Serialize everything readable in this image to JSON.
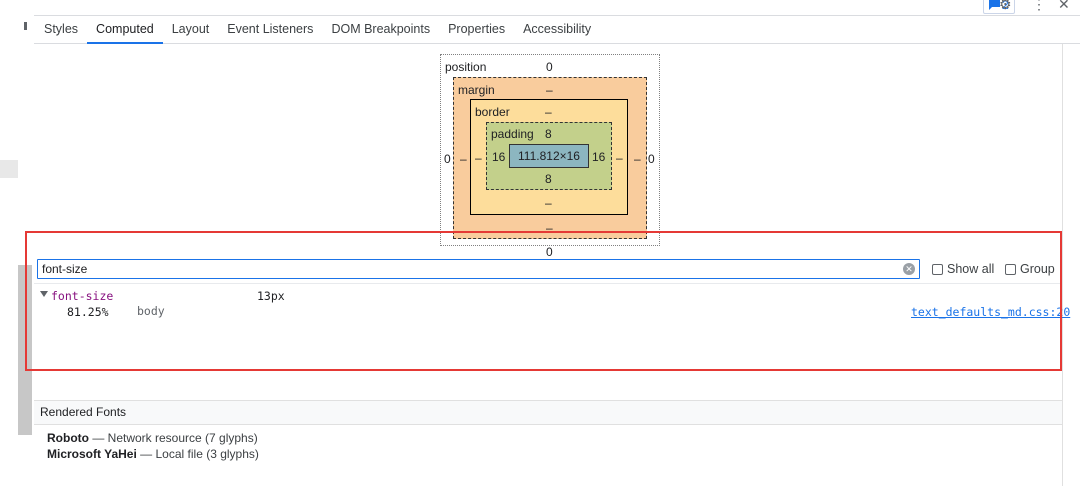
{
  "top_bar": {
    "issues_count": "2",
    "settings_icon": "gear-icon",
    "more_icon": "kebab-menu-icon",
    "close_icon": "close-icon"
  },
  "tabs": [
    {
      "label": "Styles",
      "active": false
    },
    {
      "label": "Computed",
      "active": true
    },
    {
      "label": "Layout",
      "active": false
    },
    {
      "label": "Event Listeners",
      "active": false
    },
    {
      "label": "DOM Breakpoints",
      "active": false
    },
    {
      "label": "Properties",
      "active": false
    },
    {
      "label": "Accessibility",
      "active": false
    }
  ],
  "box_model": {
    "position": {
      "label": "position",
      "top": "0",
      "right": "0",
      "bottom": "0",
      "left": "0"
    },
    "margin": {
      "label": "margin",
      "top": "–",
      "right": "–",
      "bottom": "–",
      "left": "–"
    },
    "border": {
      "label": "border",
      "top": "–",
      "right": "–",
      "bottom": "–",
      "left": "–"
    },
    "padding": {
      "label": "padding",
      "top": "8",
      "right": "16",
      "bottom": "8",
      "left": "16"
    },
    "content": "111.812×16",
    "colors": {
      "margin": "#f9cc9d",
      "border": "#fddd9b",
      "padding": "#c3d08b",
      "content": "#8cb6c0"
    }
  },
  "filter": {
    "value": "font-size",
    "show_all_label": "Show all",
    "group_label": "Group",
    "show_all_checked": false,
    "group_checked": false
  },
  "property": {
    "name": "font-size",
    "value": "13px",
    "trace": {
      "value": "81.25%",
      "selector": "body",
      "source": "text_defaults_md.css:20"
    }
  },
  "rendered_fonts": {
    "header": "Rendered Fonts",
    "fonts": [
      {
        "name": "Roboto",
        "separator": "—",
        "detail": "Network resource (7 glyphs)"
      },
      {
        "name": "Microsoft YaHei",
        "separator": "—",
        "detail": "Local file (3 glyphs)"
      }
    ]
  },
  "highlight_color": "#e53935"
}
